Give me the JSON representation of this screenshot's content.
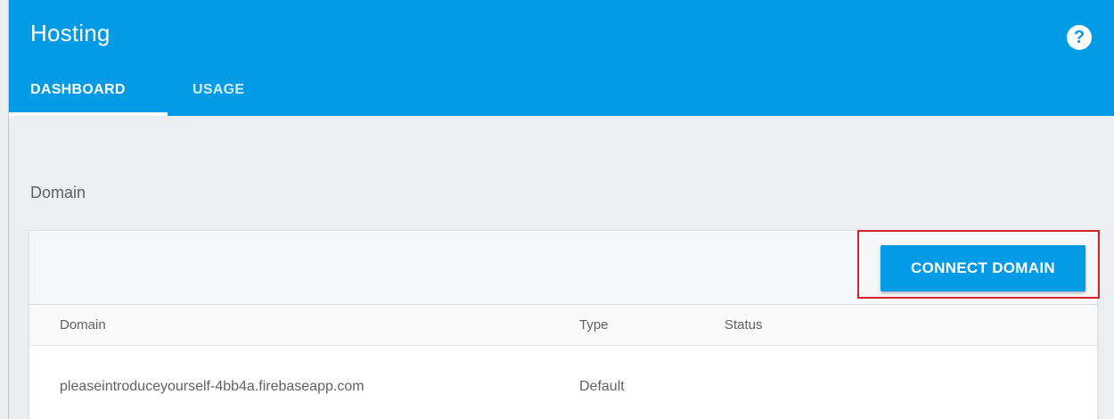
{
  "header": {
    "title": "Hosting",
    "help_icon": "question-mark-circle",
    "help_glyph": "?",
    "tabs": [
      {
        "label": "DASHBOARD",
        "active": true
      },
      {
        "label": "USAGE",
        "active": false
      }
    ]
  },
  "main": {
    "section_label": "Domain",
    "connect_button_label": "CONNECT DOMAIN",
    "highlighted": "connect-domain-button",
    "table": {
      "columns": [
        "Domain",
        "Type",
        "Status"
      ],
      "rows": [
        {
          "domain": "pleaseintroduceyourself-4bb4a.firebaseapp.com",
          "type": "Default",
          "status": ""
        }
      ]
    }
  },
  "colors": {
    "header_bg": "#039be5",
    "page_bg": "#eceff1",
    "button_bg": "#039be5",
    "highlight": "#d0262b"
  }
}
